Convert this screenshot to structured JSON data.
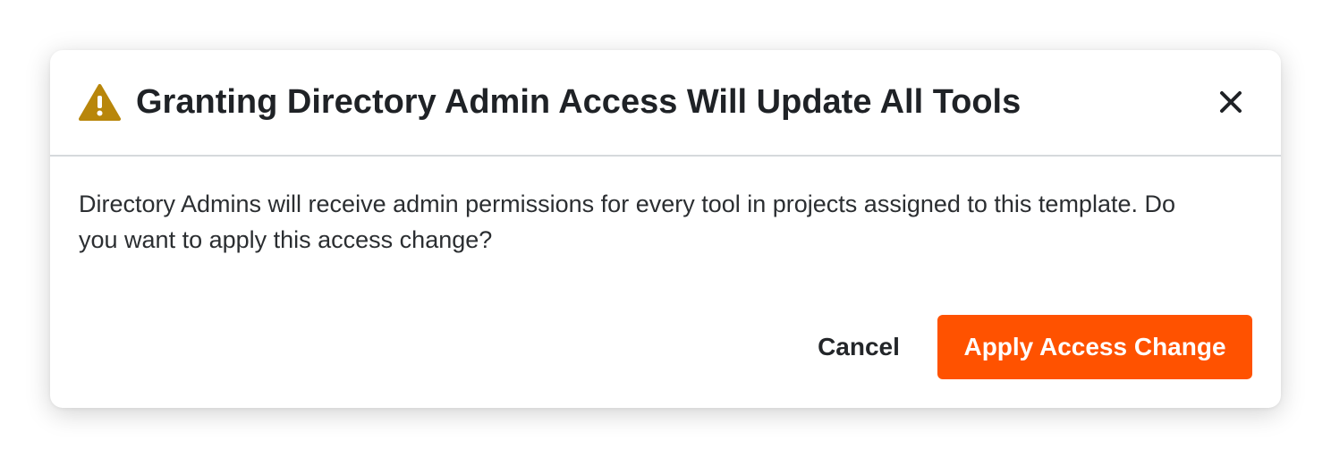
{
  "dialog": {
    "title": "Granting Directory Admin Access Will Update All Tools",
    "title_icon": "warning-icon",
    "close_icon": "close-icon",
    "message": "Directory Admins will receive admin permissions for every tool in projects assigned to this template. Do you want to apply this access change?",
    "actions": {
      "cancel_label": "Cancel",
      "confirm_label": "Apply Access Change"
    }
  },
  "colors": {
    "warning": "#b8860b",
    "primary": "#ff5200",
    "text": "#1f2226",
    "divider": "#d6d9dc"
  }
}
